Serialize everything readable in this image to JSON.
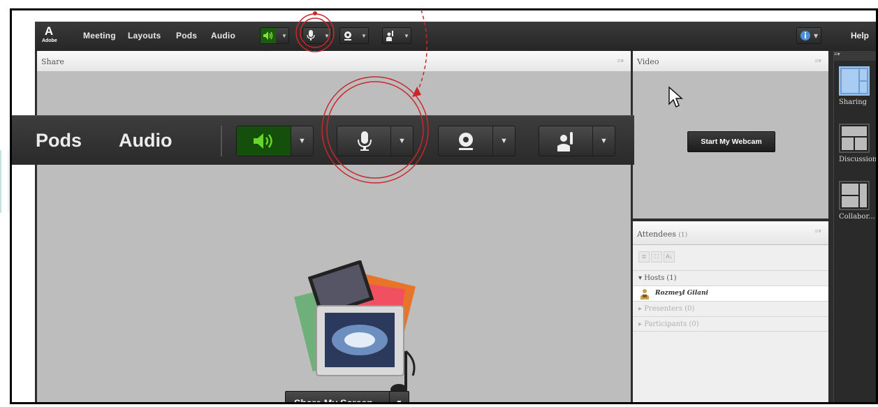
{
  "menubar": {
    "logo_text": "A",
    "logo_sub": "Adobe",
    "items": [
      "Meeting",
      "Layouts",
      "Pods",
      "Audio"
    ],
    "help_label": "Help"
  },
  "share_pod": {
    "title": "Share",
    "share_button_label": "Share My Screen"
  },
  "zoomed_toolbar": {
    "labels": [
      "Pods",
      "Audio"
    ]
  },
  "video_pod": {
    "title": "Video",
    "webcam_button_label": "Start My Webcam"
  },
  "attendees_pod": {
    "title": "Attendees",
    "count": "(1)",
    "tool_icons": [
      "list-view-icon",
      "expand-icon",
      "sort-az-icon"
    ],
    "groups": [
      {
        "label": "Hosts (1)",
        "expanded": true
      },
      {
        "label": "Presenters (0)",
        "expanded": false
      },
      {
        "label": "Participants (0)",
        "expanded": false
      }
    ],
    "host_name": "Rozmeyl Gilani"
  },
  "layouts_rail": {
    "items": [
      {
        "label": "Sharing",
        "active": true
      },
      {
        "label": "Discussion",
        "active": false
      },
      {
        "label": "Collabor...",
        "active": false
      }
    ]
  },
  "colors": {
    "accent_green": "#3fb51a",
    "annotation_red": "#c8282d",
    "active_layout": "#6f9fcf"
  }
}
